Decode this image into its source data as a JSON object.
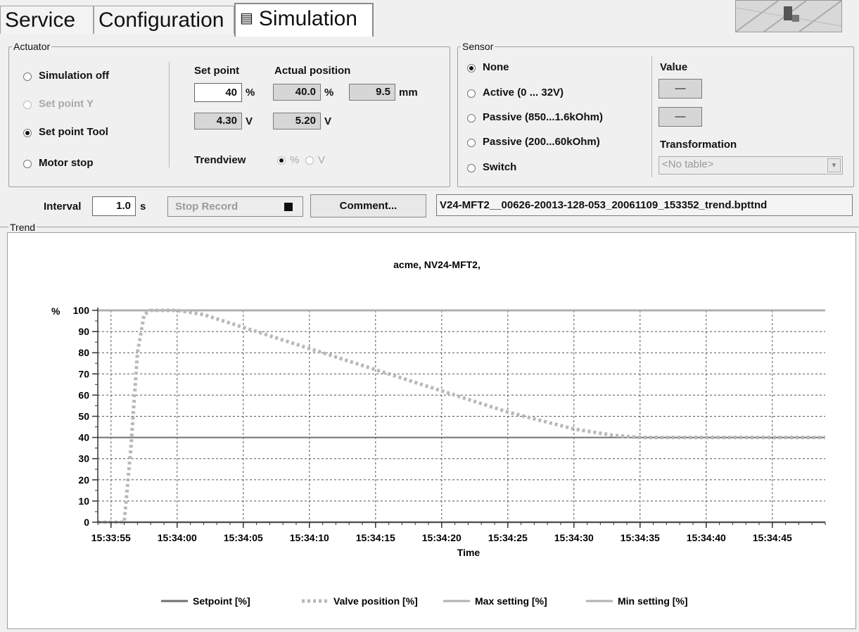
{
  "tabs": [
    {
      "label": "Service",
      "active": false
    },
    {
      "label": "Configuration",
      "active": false
    },
    {
      "label": "Simulation",
      "active": true,
      "icon": "chart-icon"
    }
  ],
  "actuator": {
    "title": "Actuator",
    "modes": [
      {
        "label": "Simulation off",
        "selected": false,
        "disabled": false
      },
      {
        "label": "Set point Y",
        "selected": false,
        "disabled": true
      },
      {
        "label": "Set point Tool",
        "selected": true,
        "disabled": false
      },
      {
        "label": "Motor stop",
        "selected": false,
        "disabled": false
      }
    ],
    "setpoint_label": "Set point",
    "actual_label": "Actual position",
    "setpoint_percent": "40",
    "percent_unit": "%",
    "actual_percent": "40.0",
    "actual_mm": "9.5",
    "mm_unit": "mm",
    "setpoint_volt": "4.30",
    "actual_volt": "5.20",
    "volt_unit": "V",
    "trendview_label": "Trendview",
    "trendview_options": [
      "%",
      "V"
    ]
  },
  "sensor": {
    "title": "Sensor",
    "options": [
      {
        "label": "None",
        "selected": true
      },
      {
        "label": "Active (0 ... 32V)",
        "selected": false
      },
      {
        "label": "Passive (850...1.6kOhm)",
        "selected": false
      },
      {
        "label": "Passive (200...60kOhm)",
        "selected": false
      },
      {
        "label": "Switch",
        "selected": false
      }
    ],
    "value_label": "Value",
    "value1": "—",
    "value2": "—",
    "transformation_label": "Transformation",
    "transformation_value": "<No table>"
  },
  "record": {
    "interval_label": "Interval",
    "interval_value": "1.0",
    "interval_unit": "s",
    "stop_label": "Stop Record",
    "comment_label": "Comment...",
    "filename": "V24-MFT2__00626-20013-128-053_20061109_153352_trend.bpttnd"
  },
  "trend": {
    "title": "Trend"
  },
  "chart_data": {
    "type": "line",
    "title": "acme, NV24-MFT2,",
    "xlabel": "Time",
    "ylabel": "%",
    "ylim": [
      0,
      100
    ],
    "yticks": [
      0,
      10,
      20,
      30,
      40,
      50,
      60,
      70,
      80,
      90,
      100
    ],
    "xticks": [
      "15:33:55",
      "15:34:00",
      "15:34:05",
      "15:34:10",
      "15:34:15",
      "15:34:20",
      "15:34:25",
      "15:34:30",
      "15:34:35",
      "15:34:40",
      "15:34:45"
    ],
    "x_start": "15:33:55",
    "x_range_seconds": [
      -1,
      54
    ],
    "grid": true,
    "legend_position": "bottom",
    "series": [
      {
        "name": "Setpoint [%]",
        "style": "solid",
        "color": "#707070",
        "points": [
          [
            -1,
            40
          ],
          [
            54,
            40
          ]
        ]
      },
      {
        "name": "Valve position [%]",
        "style": "dotted",
        "color": "#b8b8b8",
        "points": [
          [
            -1,
            0
          ],
          [
            1,
            0
          ],
          [
            1.5,
            35
          ],
          [
            2,
            80
          ],
          [
            2.5,
            98
          ],
          [
            3,
            100
          ],
          [
            5,
            100
          ],
          [
            7,
            98
          ],
          [
            10,
            92
          ],
          [
            15,
            82
          ],
          [
            20,
            72
          ],
          [
            25,
            62
          ],
          [
            30,
            52
          ],
          [
            35,
            44
          ],
          [
            38,
            41
          ],
          [
            40,
            40
          ],
          [
            54,
            40
          ]
        ]
      },
      {
        "name": "Max setting [%]",
        "style": "solid",
        "color": "#b0b0b0",
        "points": [
          [
            -1,
            100
          ],
          [
            54,
            100
          ]
        ]
      },
      {
        "name": "Min setting [%]",
        "style": "solid",
        "color": "#b0b0b0",
        "points": [
          [
            -1,
            0
          ],
          [
            54,
            0
          ]
        ]
      }
    ]
  }
}
